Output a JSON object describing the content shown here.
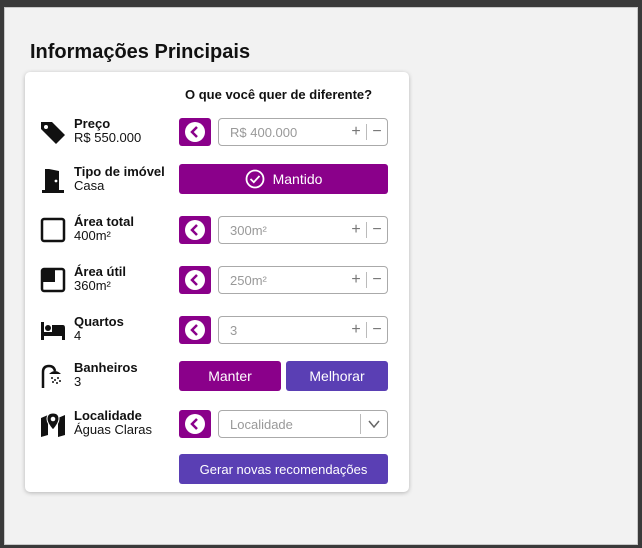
{
  "page": {
    "title": "Informações Principais"
  },
  "card": {
    "header": "O que você quer de diferente?"
  },
  "rows": {
    "price": {
      "label": "Preço",
      "value": "R$ 550.000",
      "placeholder": "R$ 400.000"
    },
    "type": {
      "label": "Tipo de imóvel",
      "value": "Casa",
      "button": "Mantido"
    },
    "total_area": {
      "label": "Área total",
      "value": "400m²",
      "placeholder": "300m²"
    },
    "useful_area": {
      "label": "Área útil",
      "value": "360m²",
      "placeholder": "250m²"
    },
    "rooms": {
      "label": "Quartos",
      "value": "4",
      "placeholder": "3"
    },
    "bathrooms": {
      "label": "Banheiros",
      "value": "3",
      "keep": "Manter",
      "improve": "Melhorar"
    },
    "location": {
      "label": "Localidade",
      "value": "Águas Claras",
      "placeholder": "Localidade"
    }
  },
  "actions": {
    "generate": "Gerar novas recomendações"
  },
  "stepper": {
    "plus": "+",
    "minus": "−"
  },
  "colors": {
    "primary": "#8a008a",
    "secondary": "#5a3fb4"
  }
}
